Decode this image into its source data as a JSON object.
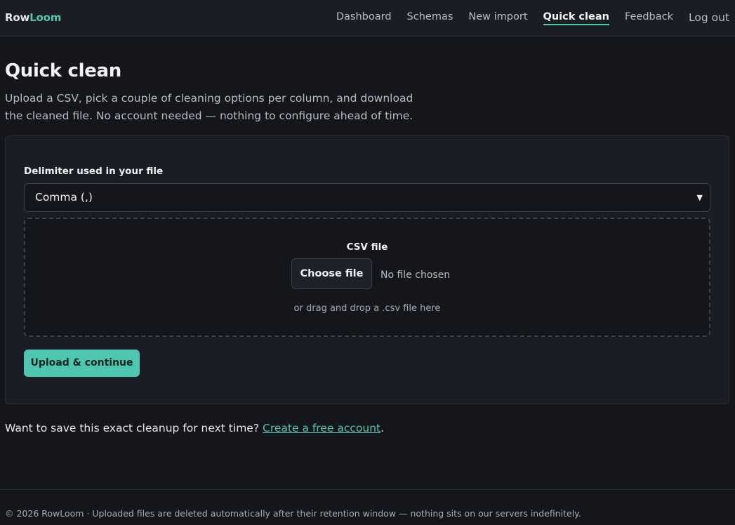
{
  "brand": {
    "part1": "Row",
    "part2": "Loom"
  },
  "nav": {
    "items": [
      {
        "label": "Dashboard"
      },
      {
        "label": "Schemas"
      },
      {
        "label": "New import"
      },
      {
        "label": "Quick clean",
        "active": true
      },
      {
        "label": "Feedback"
      },
      {
        "label": "Log out"
      }
    ]
  },
  "page": {
    "title": "Quick clean",
    "intro": "Upload a CSV, pick a couple of cleaning options per column, and download the cleaned file. No account needed — nothing to configure ahead of time."
  },
  "form": {
    "delimiter_label": "Delimiter used in your file",
    "delimiter_value": "Comma (,)",
    "file_label": "CSV file",
    "choose_file": "Choose file",
    "no_file": "No file chosen",
    "drop_hint": "or drag and drop a .csv file here",
    "submit": "Upload & continue"
  },
  "save_note": {
    "text": "Want to save this exact cleanup for next time?",
    "link": "Create a free account",
    "suffix": "."
  },
  "footer": {
    "text": "© 2026 RowLoom · Uploaded files are deleted automatically after their retention window — nothing sits on our servers indefinitely."
  },
  "colors": {
    "accent": "#4fc6b0",
    "background": "#14161b",
    "surface": "#1a1d23"
  }
}
